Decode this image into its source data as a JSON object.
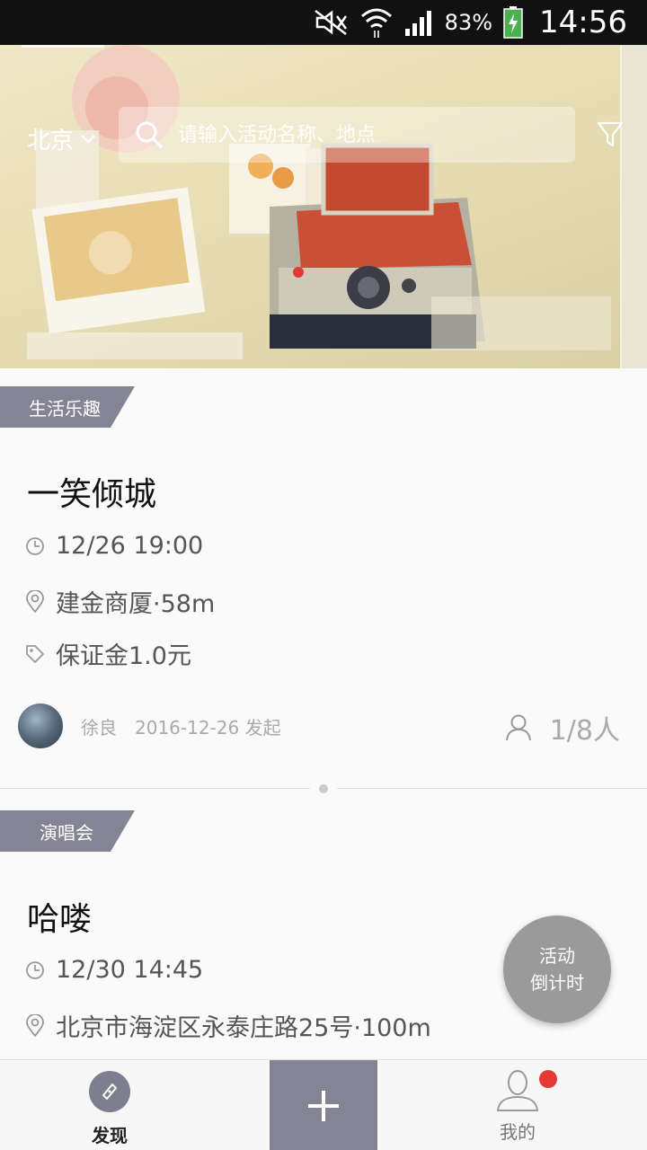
{
  "status_bar": {
    "battery": "83%",
    "time": "14:56"
  },
  "header": {
    "city": "北京",
    "search_placeholder": "请输入活动名称、地点"
  },
  "events": [
    {
      "tag": "生活乐趣",
      "title": "一笑倾城",
      "time": "12/26 19:00",
      "location": "建金商厦·58m",
      "deposit": "保证金1.0元",
      "publisher_name": "徐良",
      "publisher_date": "2016-12-26 发起",
      "participants": "1/8人"
    },
    {
      "tag": "演唱会",
      "title": "哈喽",
      "time": "12/30 14:45",
      "location": "北京市海淀区永泰庄路25号·100m"
    }
  ],
  "fab": {
    "line1": "活动",
    "line2": "倒计时"
  },
  "bottom_nav": {
    "discover": "发现",
    "mine": "我的"
  },
  "colors": {
    "accent": "#858494",
    "notification": "#e53935"
  }
}
